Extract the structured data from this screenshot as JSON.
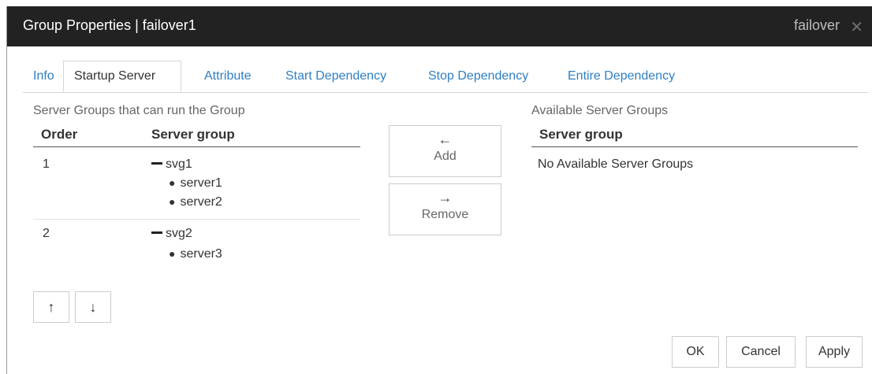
{
  "window": {
    "title": "Group Properties | failover1",
    "right_label": "failover",
    "close_glyph": "✕"
  },
  "tabs": [
    {
      "label": "Info"
    },
    {
      "label": "Startup Server"
    },
    {
      "label": "Attribute"
    },
    {
      "label": "Start Dependency"
    },
    {
      "label": "Stop Dependency"
    },
    {
      "label": "Entire Dependency"
    }
  ],
  "active_tab": "Startup Server",
  "left_panel": {
    "title": "Server Groups that can run the Group",
    "columns": [
      "Order",
      "Server group"
    ],
    "rows": [
      {
        "order": "1",
        "group": "svg1",
        "servers": [
          "server1",
          "server2"
        ]
      },
      {
        "order": "2",
        "group": "svg2",
        "servers": [
          "server3"
        ]
      }
    ]
  },
  "middle_buttons": {
    "add": {
      "arrow": "←",
      "label": "Add"
    },
    "remove": {
      "arrow": "→",
      "label": "Remove"
    }
  },
  "order_buttons": {
    "up": "↑",
    "down": "↓"
  },
  "right_panel": {
    "title": "Available Server Groups",
    "column": "Server group",
    "empty_text": "No Available Server Groups"
  },
  "footer": {
    "ok": "OK",
    "cancel": "Cancel",
    "apply": "Apply"
  }
}
